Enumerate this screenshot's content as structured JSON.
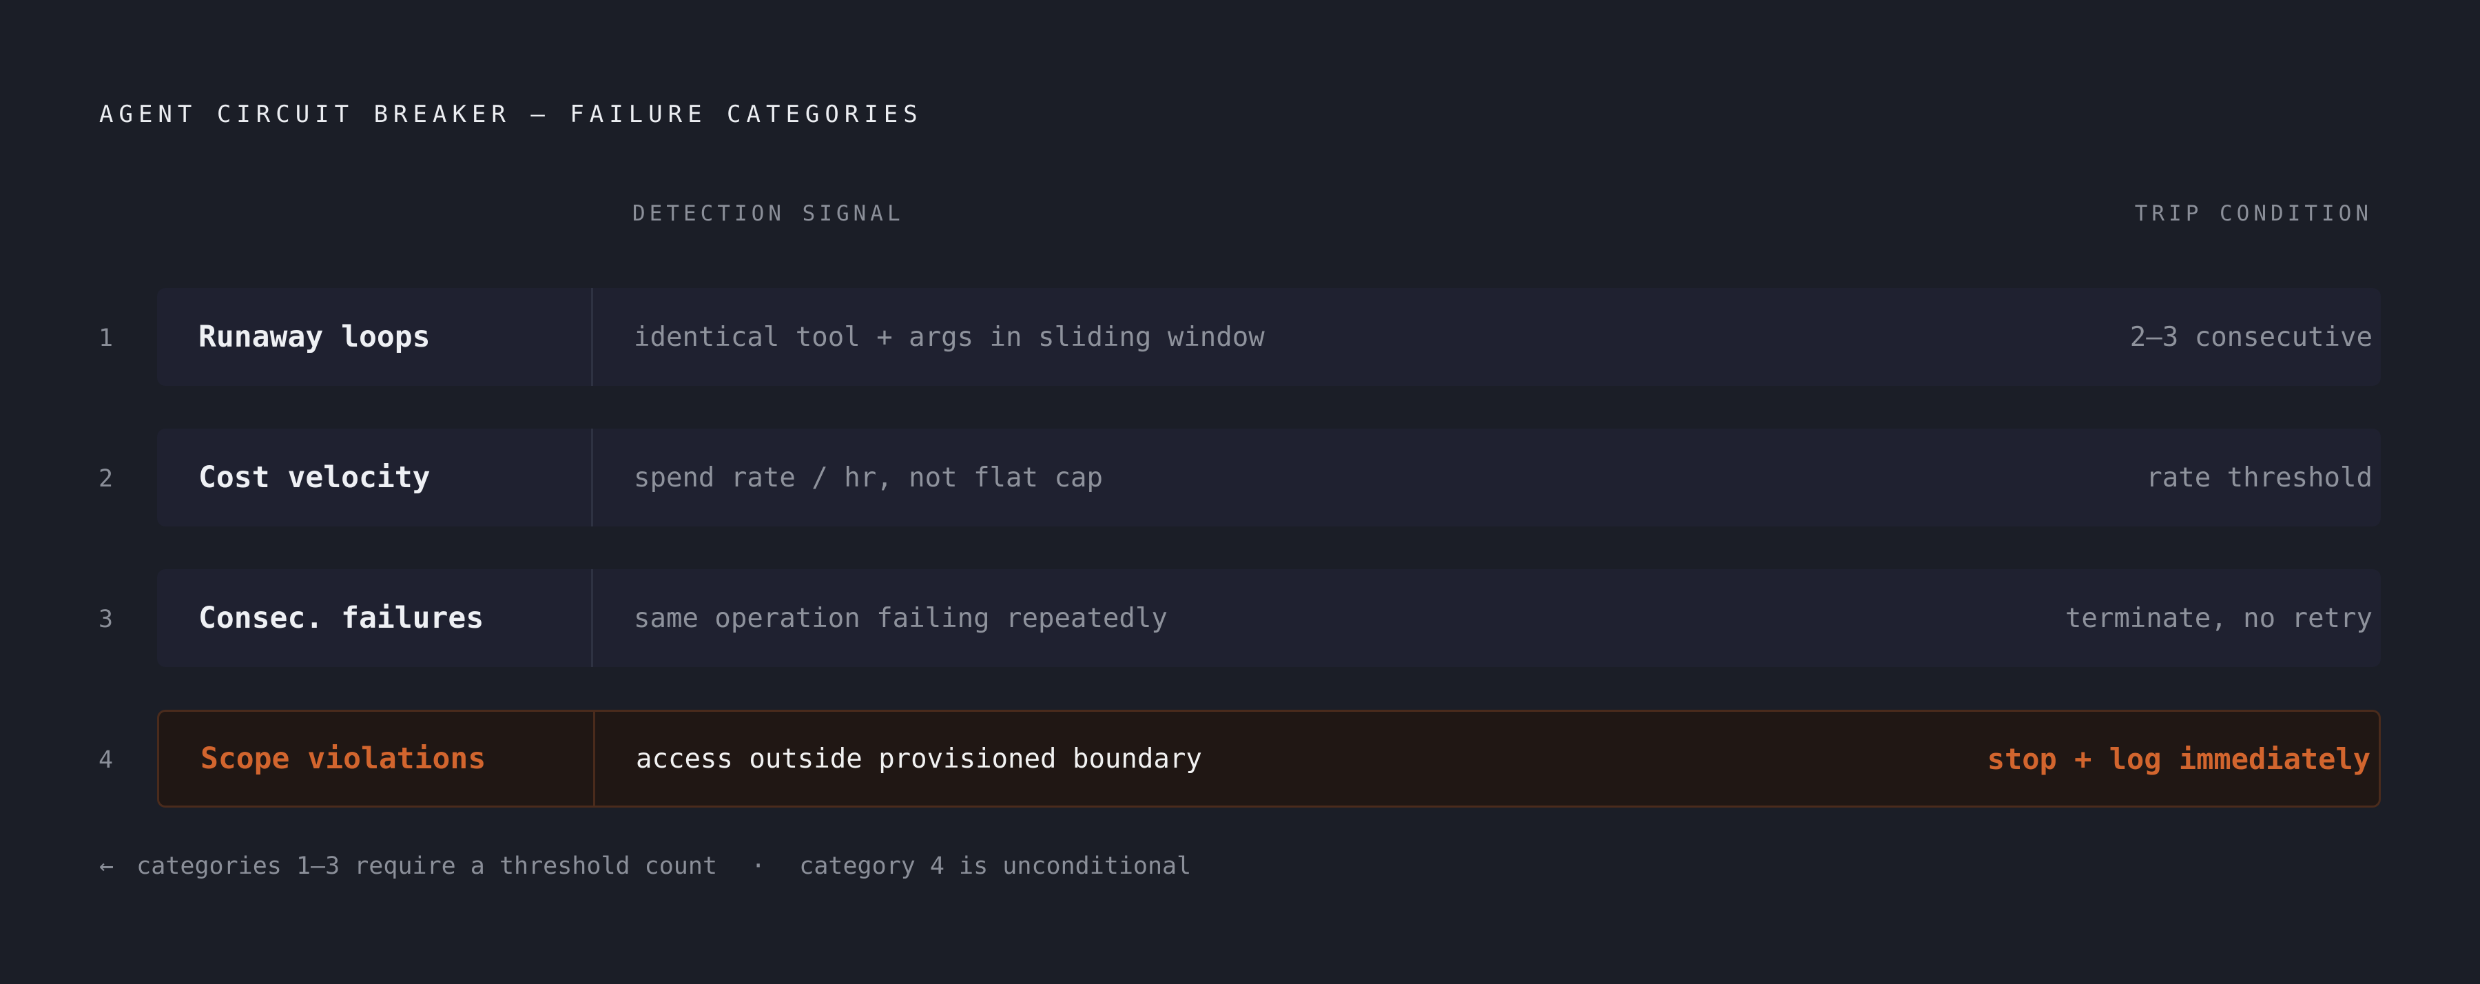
{
  "title": "AGENT CIRCUIT BREAKER — FAILURE CATEGORIES",
  "columns": {
    "signal": "DETECTION SIGNAL",
    "trip": "TRIP CONDITION"
  },
  "rows": [
    {
      "num": "1",
      "name": "Runaway loops",
      "signal": "identical tool + args in sliding window",
      "trip": "2–3 consecutive"
    },
    {
      "num": "2",
      "name": "Cost velocity",
      "signal": "spend rate / hr, not flat cap",
      "trip": "rate threshold"
    },
    {
      "num": "3",
      "name": "Consec. failures",
      "signal": "same operation failing repeatedly",
      "trip": "terminate, no retry"
    },
    {
      "num": "4",
      "name": "Scope violations",
      "signal": "access outside provisioned boundary",
      "trip": "stop + log immediately"
    }
  ],
  "footnote": {
    "arrow": "←",
    "left": "categories 1–3 require a threshold count",
    "separator": "·",
    "right": "category 4 is unconditional"
  },
  "colors": {
    "background": "#1b1e27",
    "row": "#1f2130",
    "highlight_row": "#201714",
    "accent": "#d2652e"
  }
}
